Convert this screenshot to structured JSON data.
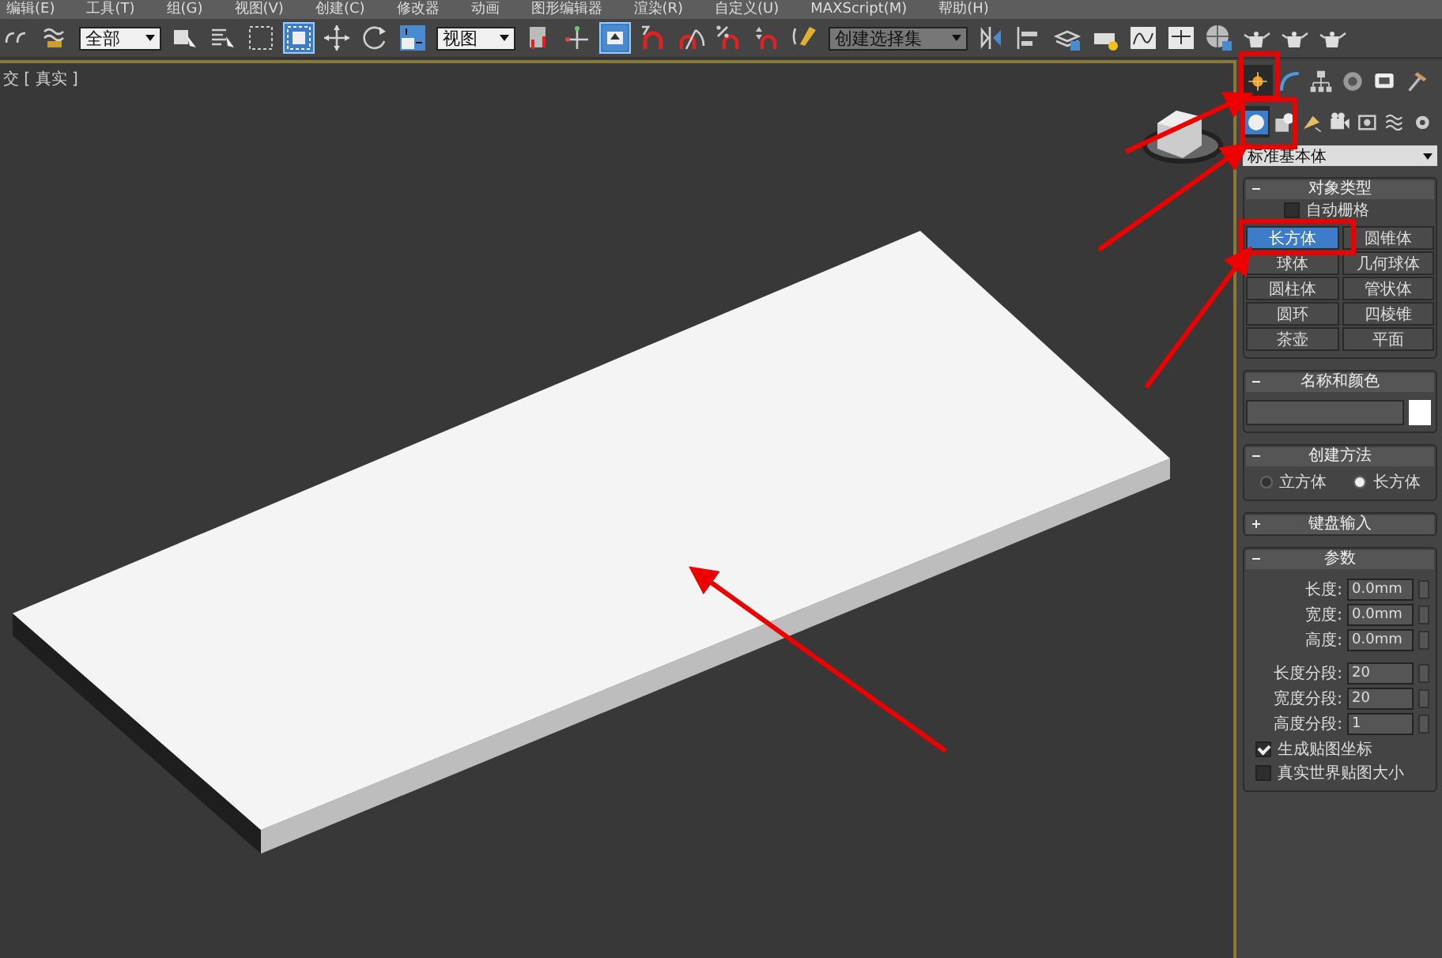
{
  "menu": [
    {
      "label": "编辑(E)"
    },
    {
      "label": "工具(T)"
    },
    {
      "label": "组(G)"
    },
    {
      "label": "视图(V)"
    },
    {
      "label": "创建(C)"
    },
    {
      "label": "修改器"
    },
    {
      "label": "动画"
    },
    {
      "label": "图形编辑器"
    },
    {
      "label": "渲染(R)"
    },
    {
      "label": "自定义(U)"
    },
    {
      "label": "MAXScript(M)"
    },
    {
      "label": "帮助(H)"
    }
  ],
  "toolbar": {
    "selection_filter": "全部",
    "reference_coord": "视图",
    "named_selection": "创建选择集",
    "window_crossing_on": true,
    "keyboard_override_on": true
  },
  "viewport": {
    "label": "交 [ 真实 ]"
  },
  "command_panel": {
    "tabs": [
      {
        "selected": true
      },
      {
        "selected": false
      },
      {
        "selected": false
      },
      {
        "selected": false
      },
      {
        "selected": false
      },
      {
        "selected": false
      }
    ],
    "categories": [
      {
        "selected": true
      },
      {
        "selected": false
      },
      {
        "selected": false
      },
      {
        "selected": false
      },
      {
        "selected": false
      },
      {
        "selected": false
      },
      {
        "selected": false
      }
    ],
    "dropdown": "标准基本体",
    "object_type": {
      "title": "对象类型",
      "expanded": true,
      "autogrid": {
        "label": "自动栅格",
        "checked": false
      },
      "buttons": [
        {
          "label": "长方体",
          "selected": true
        },
        {
          "label": "圆锥体",
          "selected": false
        },
        {
          "label": "球体",
          "selected": false
        },
        {
          "label": "几何球体",
          "selected": false
        },
        {
          "label": "圆柱体",
          "selected": false
        },
        {
          "label": "管状体",
          "selected": false
        },
        {
          "label": "圆环",
          "selected": false
        },
        {
          "label": "四棱锥",
          "selected": false
        },
        {
          "label": "茶壶",
          "selected": false
        },
        {
          "label": "平面",
          "selected": false
        }
      ]
    },
    "name_color": {
      "title": "名称和颜色",
      "expanded": true,
      "color": "#ffffff"
    },
    "creation_method": {
      "title": "创建方法",
      "expanded": true,
      "options": [
        {
          "label": "立方体",
          "selected": false
        },
        {
          "label": "长方体",
          "selected": true
        }
      ]
    },
    "keyboard_entry": {
      "title": "键盘输入",
      "expanded": false
    },
    "parameters": {
      "title": "参数",
      "expanded": true,
      "fields": [
        {
          "label": "长度:",
          "value": "0.0mm"
        },
        {
          "label": "宽度:",
          "value": "0.0mm"
        },
        {
          "label": "高度:",
          "value": "0.0mm"
        }
      ],
      "segments": [
        {
          "label": "长度分段:",
          "value": "20"
        },
        {
          "label": "宽度分段:",
          "value": "20"
        },
        {
          "label": "高度分段:",
          "value": "1"
        }
      ],
      "checks": [
        {
          "label": "生成贴图坐标",
          "checked": true
        },
        {
          "label": "真实世界贴图大小",
          "checked": false
        }
      ]
    }
  }
}
